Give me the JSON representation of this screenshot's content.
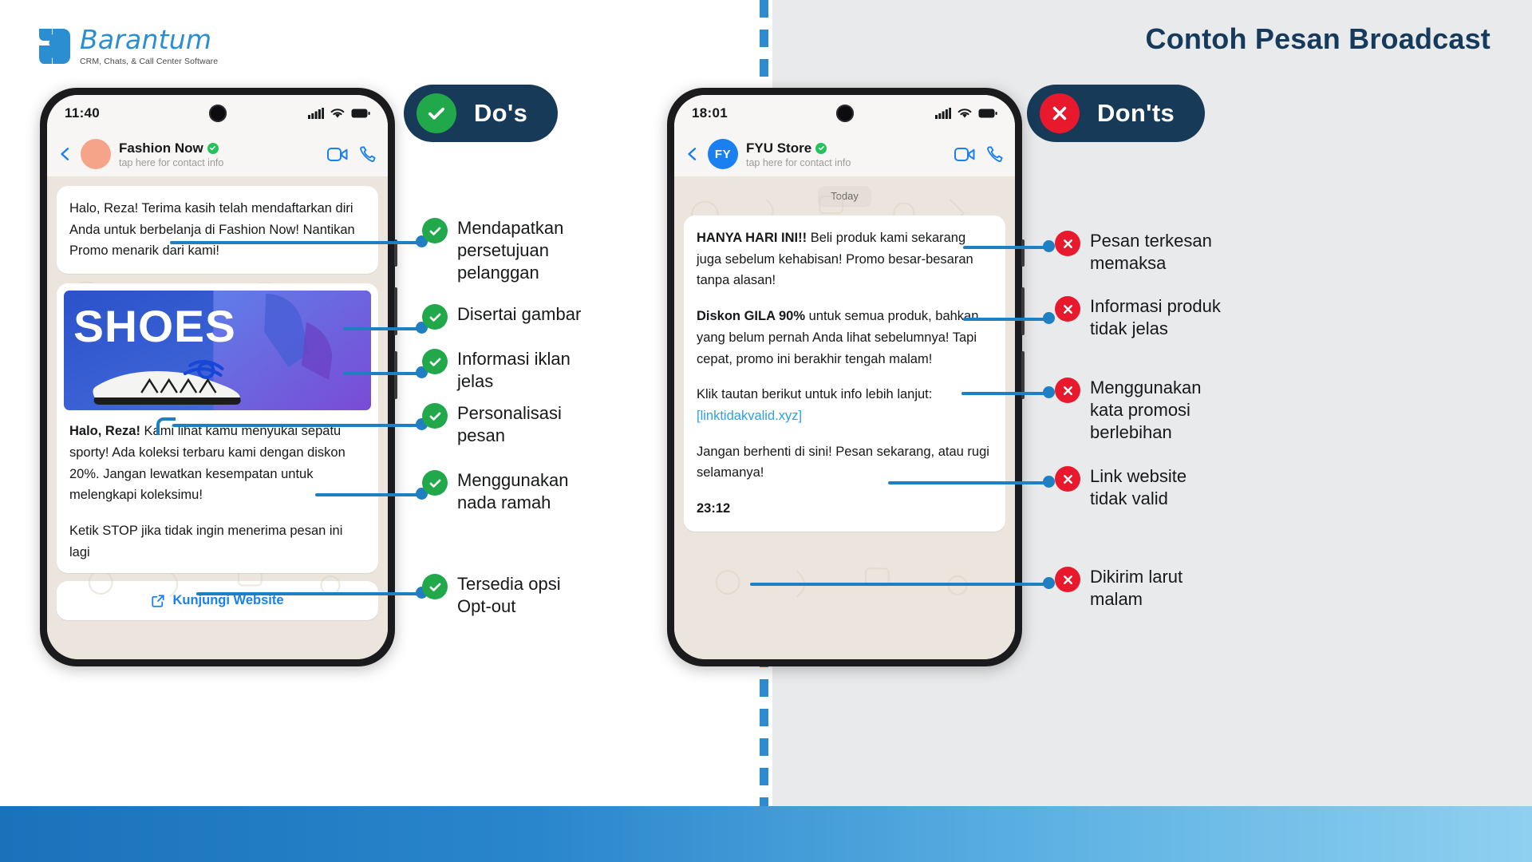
{
  "brand": {
    "name": "Barantum",
    "tagline": "CRM, Chats, & Call Center Software"
  },
  "headline": "Contoh Pesan Broadcast",
  "colors": {
    "accent_blue": "#1f7fc0",
    "brand_blue": "#2b8ed0",
    "navy": "#163a58",
    "green": "#21a84a",
    "red": "#e8192c",
    "link": "#2e9fe0",
    "panel_right_bg": "#e9eaeb",
    "chat_bg": "#ece5dd"
  },
  "dos": {
    "pill_label": "Do's",
    "pill_icon": "check-circle-icon",
    "phone": {
      "status_time": "11:40",
      "signal_icon": "signal-bars-icon",
      "wifi_icon": "wifi-icon",
      "battery_icon": "battery-icon",
      "back_icon": "back-chevron-icon",
      "contact_name": "Fashion Now",
      "verified_icon": "verified-badge-icon",
      "contact_sub": "tap here for contact info",
      "video_icon": "video-call-icon",
      "phone_icon": "phone-call-icon",
      "avatar_initials": ""
    },
    "messages": {
      "msg1": "Halo, Reza! Terima kasih telah mendaftarkan diri Anda untuk berbelanja di Fashion Now! Nantikan Promo menarik dari kami!",
      "img_alt": "SHOES",
      "img_word": "SHOES",
      "msg2_bold": "Halo, Reza!",
      "msg2_rest": " Kami lihat kamu menyukai sepatu sporty! Ada koleksi terbaru kami dengan diskon 20%. Jangan lewatkan kesempatan untuk melengkapi koleksimu!",
      "msg2_optout": "Ketik STOP jika tidak ingin menerima pesan ini lagi",
      "cta_label": "Kunjungi Website",
      "cta_icon": "external-link-icon"
    },
    "items": [
      {
        "label": "Mendapatkan persetujuan pelanggan",
        "icon": "check-circle-icon"
      },
      {
        "label": "Disertai gambar",
        "icon": "check-circle-icon"
      },
      {
        "label": "Informasi iklan jelas",
        "icon": "check-circle-icon"
      },
      {
        "label": "Personalisasi pesan",
        "icon": "check-circle-icon"
      },
      {
        "label": "Menggunakan nada ramah",
        "icon": "check-circle-icon"
      },
      {
        "label": "Tersedia opsi Opt-out",
        "icon": "check-circle-icon"
      }
    ]
  },
  "donts": {
    "pill_label": "Don'ts",
    "pill_icon": "x-circle-icon",
    "phone": {
      "status_time": "18:01",
      "signal_icon": "signal-bars-icon",
      "wifi_icon": "wifi-icon",
      "battery_icon": "battery-icon",
      "back_icon": "back-chevron-icon",
      "contact_name": "FYU Store",
      "verified_icon": "verified-badge-icon",
      "contact_sub": "tap here for contact info",
      "video_icon": "video-call-icon",
      "phone_icon": "phone-call-icon",
      "avatar_initials": "FY"
    },
    "messages": {
      "day_chip": "Today",
      "p1_bold": "HANYA HARI INI!!",
      "p1_rest": " Beli produk kami sekarang juga sebelum kehabisan! Promo besar-besaran tanpa alasan!",
      "p2_bold": "Diskon GILA 90%",
      "p2_rest": " untuk semua produk, bahkan yang belum pernah Anda lihat sebelumnya! Tapi cepat, promo ini berakhir tengah malam!",
      "p3_pre": "Klik tautan berikut untuk info lebih lanjut: ",
      "p3_link": "[linktidakvalid.xyz]",
      "p4": "Jangan berhenti di sini! Pesan sekarang, atau rugi selamanya!",
      "timestamp": "23:12"
    },
    "items": [
      {
        "label": "Pesan terkesan memaksa",
        "icon": "x-circle-icon"
      },
      {
        "label": "Informasi produk tidak jelas",
        "icon": "x-circle-icon"
      },
      {
        "label": "Menggunakan kata promosi berlebihan",
        "icon": "x-circle-icon"
      },
      {
        "label": "Link website tidak valid",
        "icon": "x-circle-icon"
      },
      {
        "label": "Dikirim larut malam",
        "icon": "x-circle-icon"
      }
    ]
  }
}
